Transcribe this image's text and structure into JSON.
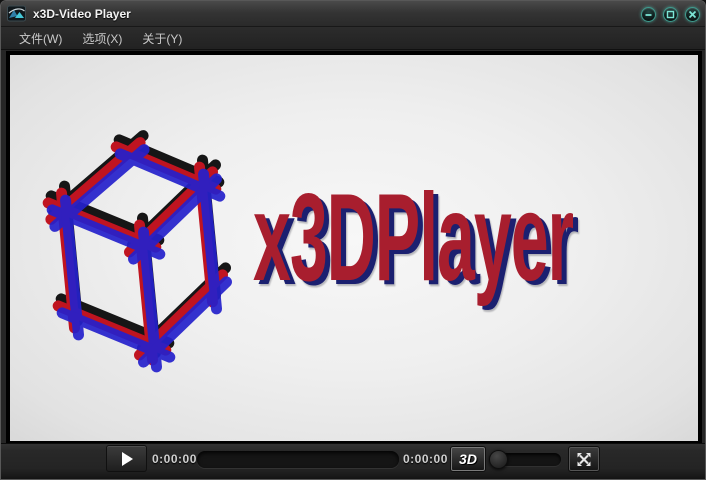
{
  "window": {
    "title": "x3D-Video Player",
    "app_icon": "mountain-photo-icon",
    "controls": {
      "minimize": "minimize",
      "maximize": "maximize",
      "close": "close"
    }
  },
  "menu": {
    "items": [
      "文件(W)",
      "选项(X)",
      "关于(Y)"
    ]
  },
  "video": {
    "logo_text": "x3DPlayer",
    "logo_icon": "anaglyph-wireframe-cube"
  },
  "controls": {
    "play_icon": "play-triangle",
    "elapsed": "0:00:00",
    "total": "0:00:00",
    "progress_percent": 0,
    "mode_label": "3D",
    "volume_percent": 0,
    "fullscreen_icon": "expand-arrows"
  },
  "colors": {
    "accent_teal": "#58dcc9",
    "logo_red": "#a81e2e",
    "logo_shadow_blue": "#1b2070",
    "cube_red": "#c01420",
    "cube_blue": "#2521cc",
    "cube_black": "#161616"
  }
}
